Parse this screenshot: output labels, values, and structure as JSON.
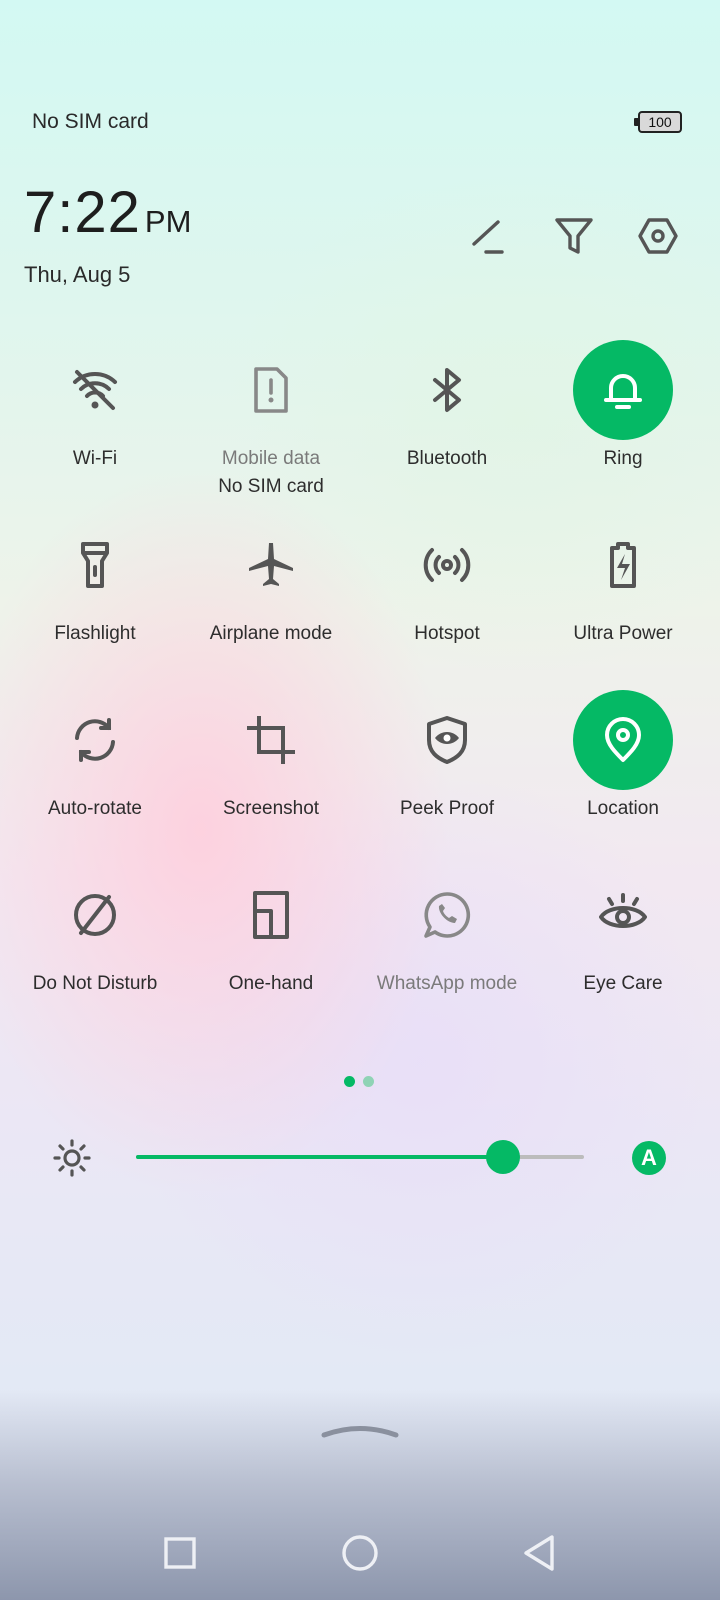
{
  "status": {
    "carrier": "No SIM card",
    "battery": "100"
  },
  "header": {
    "time": "7:22",
    "ampm": "PM",
    "date": "Thu, Aug 5"
  },
  "header_actions": [
    "edit-icon",
    "filter-icon",
    "settings-icon"
  ],
  "tiles": [
    {
      "label": "Wi-Fi",
      "icon": "wifi-icon",
      "active": false
    },
    {
      "label": "Mobile data",
      "sublabel": "No SIM card",
      "icon": "mobile-data-icon",
      "active": false,
      "disabled": true
    },
    {
      "label": "Bluetooth",
      "icon": "bluetooth-icon",
      "active": false
    },
    {
      "label": "Ring",
      "icon": "bell-icon",
      "active": true
    },
    {
      "label": "Flashlight",
      "icon": "flashlight-icon",
      "active": false
    },
    {
      "label": "Airplane mode",
      "icon": "airplane-icon",
      "active": false
    },
    {
      "label": "Hotspot",
      "icon": "hotspot-icon",
      "active": false
    },
    {
      "label": "Ultra Power",
      "icon": "battery-bolt-icon",
      "active": false
    },
    {
      "label": "Auto-rotate",
      "icon": "rotate-icon",
      "active": false
    },
    {
      "label": "Screenshot",
      "icon": "crop-icon",
      "active": false
    },
    {
      "label": "Peek Proof",
      "icon": "peek-proof-icon",
      "active": false
    },
    {
      "label": "Location",
      "icon": "location-pin-icon",
      "active": true
    },
    {
      "label": "Do Not Disturb",
      "icon": "do-not-disturb-icon",
      "active": false
    },
    {
      "label": "One-hand",
      "icon": "one-hand-icon",
      "active": false
    },
    {
      "label": "WhatsApp mode",
      "icon": "whatsapp-icon",
      "active": false,
      "disabled": true
    },
    {
      "label": "Eye Care",
      "icon": "eye-icon",
      "active": false
    }
  ],
  "pager": {
    "pages": 2,
    "current": 1
  },
  "brightness": {
    "level": 0.82,
    "auto_label": "A"
  },
  "colors": {
    "accent": "#05b965",
    "icon": "#555555"
  },
  "navbar": [
    "recents-square-icon",
    "home-circle-icon",
    "back-triangle-icon"
  ]
}
